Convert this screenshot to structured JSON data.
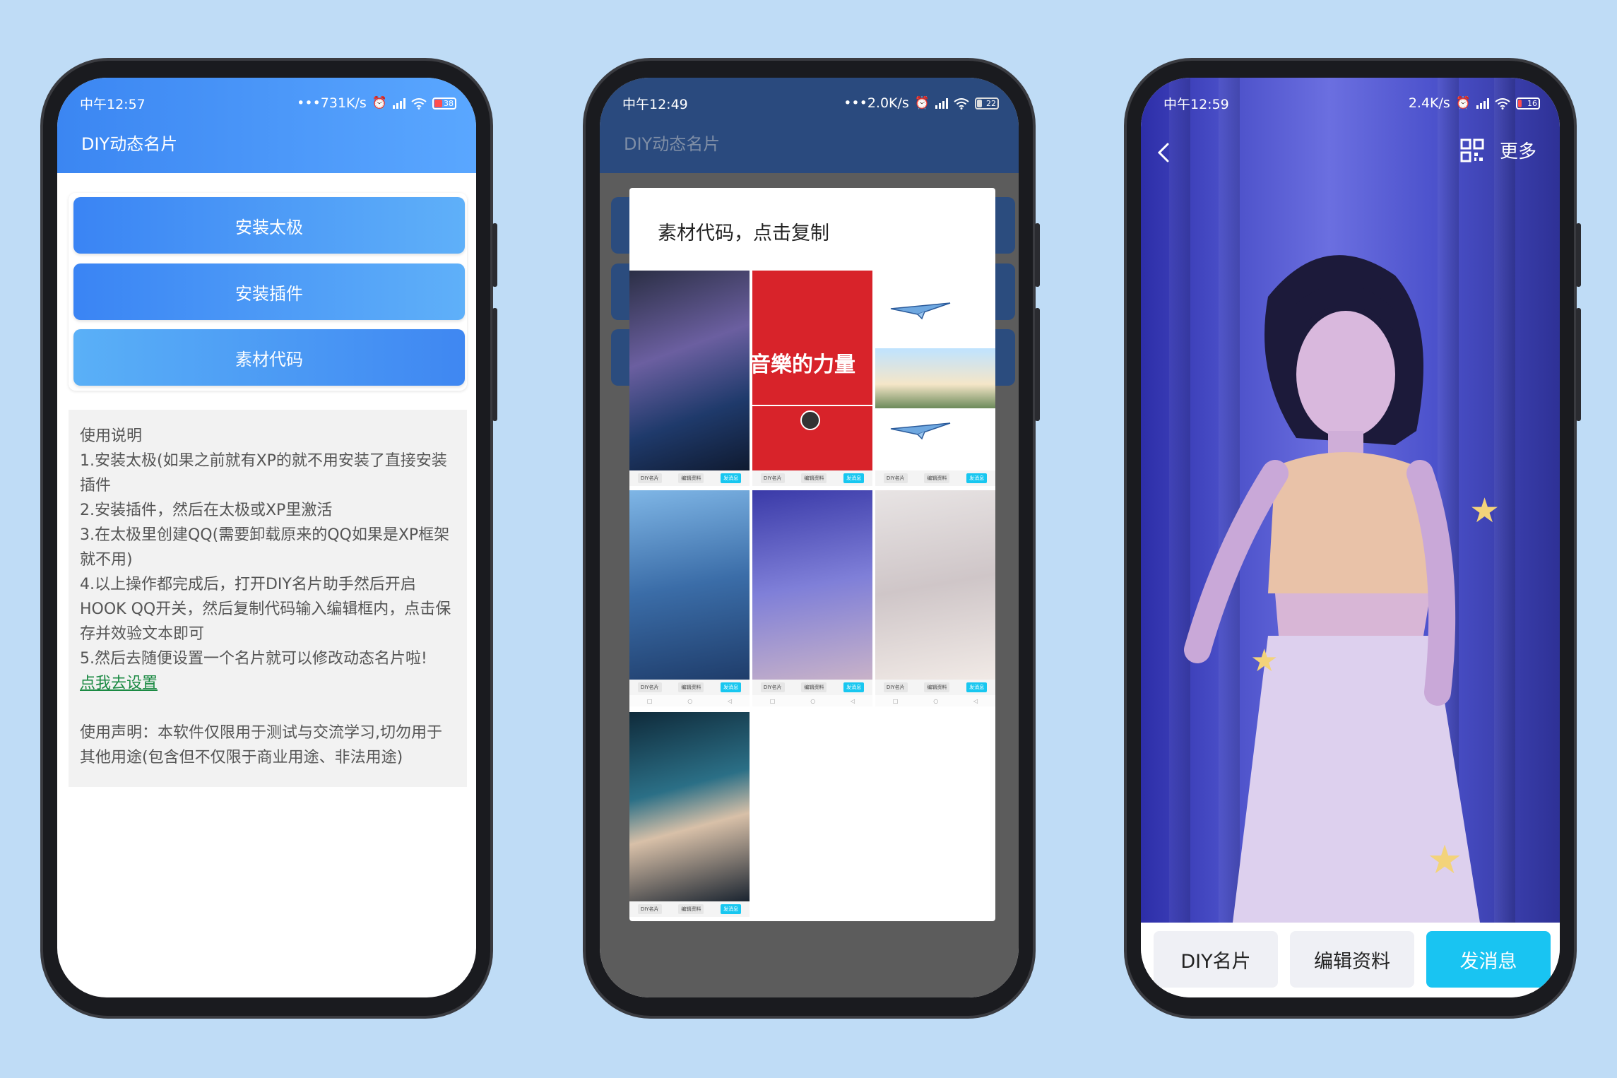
{
  "colors": {
    "background": "#bfdcf6",
    "primary_blue": "#3b86f2",
    "link_green": "#1b8a43",
    "accent_cyan": "#19c4f2",
    "battery_red": "#ff4d4d"
  },
  "phone1": {
    "status": {
      "time": "中午12:57",
      "net": "•••731K/s",
      "battery": "38"
    },
    "app_title": "DIY动态名片",
    "buttons": {
      "install_taichi": "安装太极",
      "install_plugin": "安装插件",
      "material_code": "素材代码"
    },
    "instructions": {
      "heading": "使用说明",
      "steps": [
        "1.安装太极(如果之前就有XP的就不用安装了直接安装插件",
        "2.安装插件，然后在太极或XP里激活",
        "3.在太极里创建QQ(需要卸载原来的QQ如果是XP框架就不用)",
        "4.以上操作都完成后，打开DIY名片助手然后开启HOOK QQ开关，然后复制代码输入编辑框内，点击保存并效验文本即可",
        "5.然后去随便设置一个名片就可以修改动态名片啦!"
      ],
      "link": "点我去设置",
      "disclaimer": "使用声明：本软件仅限用于测试与交流学习,切勿用于其他用途(包含但不仅限于商业用途、非法用途)"
    }
  },
  "phone2": {
    "status": {
      "time": "中午12:49",
      "net": "•••2.0K/s",
      "battery": "22"
    },
    "app_title": "DIY动态名片",
    "dialog_title": "素材代码，点击复制",
    "red_thumb_text": "音樂的力量",
    "thumb_bar": {
      "diy": "DIY名片",
      "edit": "编辑资料",
      "send": "发消息"
    }
  },
  "phone3": {
    "status": {
      "time": "中午12:59",
      "net": "2.4K/s",
      "battery": "16"
    },
    "more_label": "更多",
    "buttons": {
      "diy_card": "DIY名片",
      "edit_profile": "编辑资料",
      "send_message": "发消息"
    }
  }
}
